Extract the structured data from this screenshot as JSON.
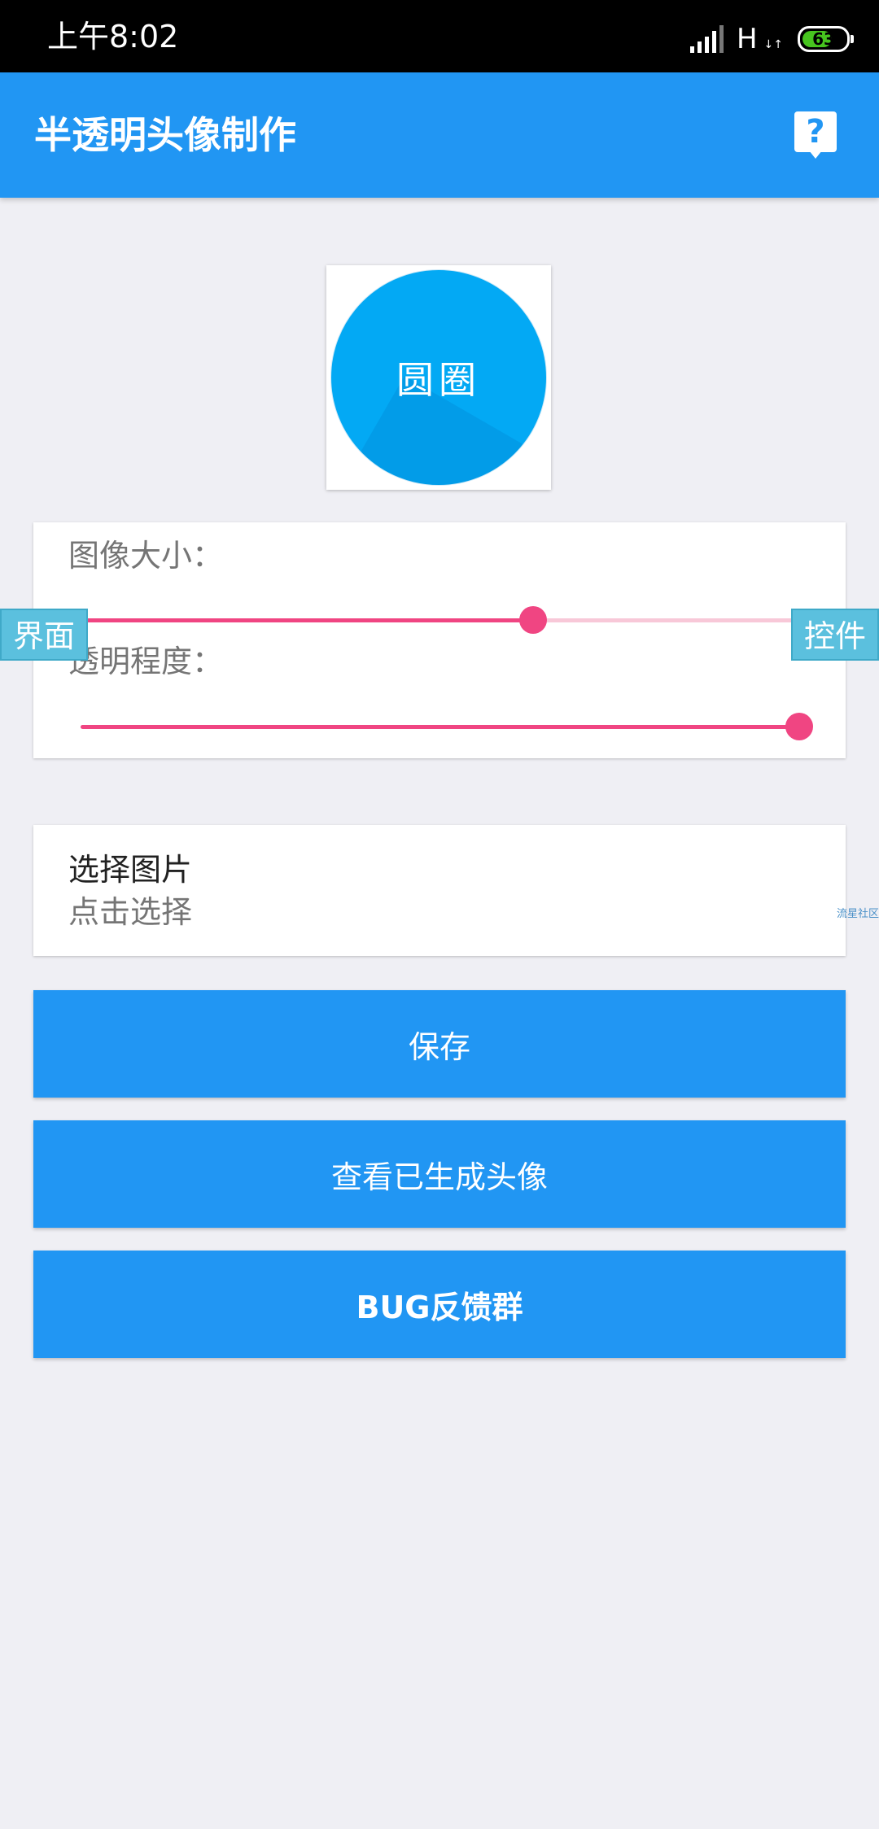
{
  "status_bar": {
    "time": "上午8:02",
    "network_type": "H",
    "network_arrows": "↓↑",
    "battery_level": "63",
    "battery_color": "#47c51f"
  },
  "app_bar": {
    "title": "半透明头像制作",
    "help_icon": "question-mark-icon",
    "help_glyph": "?",
    "color": "#2196f3"
  },
  "preview": {
    "text": "圆圈",
    "circle_color": "#03a9f4"
  },
  "sliders": [
    {
      "label": "图像大小：",
      "value": 0.63
    },
    {
      "label": "透明程度：",
      "value": 1.0
    }
  ],
  "side_tags": {
    "left": "界面",
    "right": "控件"
  },
  "choose_image": {
    "title": "选择图片",
    "subtitle": "点击选择"
  },
  "watermark": "流星社区",
  "buttons": {
    "save": "保存",
    "view_generated": "查看已生成头像",
    "bug_feedback": "BUG反馈群"
  },
  "accent_color": "#f04582"
}
